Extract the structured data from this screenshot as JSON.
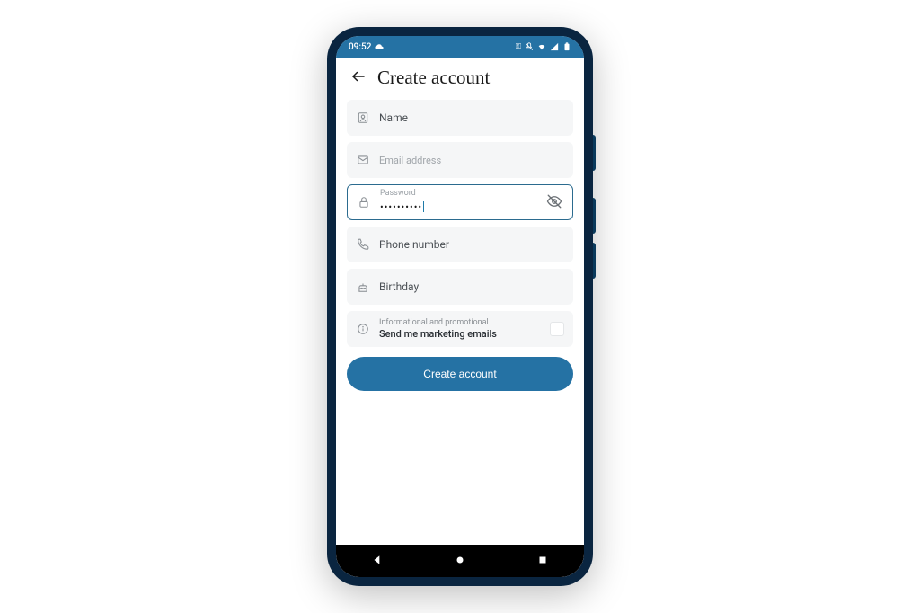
{
  "status": {
    "time": "09:52"
  },
  "header": {
    "title": "Create account"
  },
  "fields": {
    "name": {
      "placeholder": "Name"
    },
    "email": {
      "placeholder": "Email address"
    },
    "password": {
      "label": "Password",
      "value_masked": "••••••••••"
    },
    "phone": {
      "placeholder": "Phone number"
    },
    "birthday": {
      "placeholder": "Birthday"
    }
  },
  "marketing": {
    "small": "Informational and promotional",
    "label": "Send me marketing emails",
    "checked": false
  },
  "cta": {
    "label": "Create account"
  },
  "colors": {
    "brand": "#2572a4",
    "field_bg": "#f5f6f7"
  }
}
